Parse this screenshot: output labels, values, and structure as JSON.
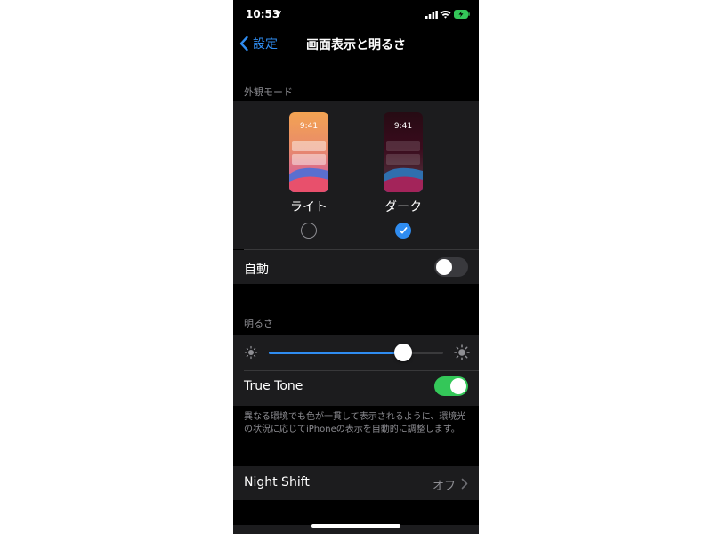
{
  "status_bar": {
    "time": "10:53"
  },
  "nav": {
    "back_label": "設定",
    "title": "画面表示と明るさ"
  },
  "appearance": {
    "section_title": "外観モード",
    "options": [
      {
        "label": "ライト",
        "preview_time": "9:41",
        "selected": false
      },
      {
        "label": "ダーク",
        "preview_time": "9:41",
        "selected": true
      }
    ],
    "auto_label": "自動",
    "auto_enabled": false
  },
  "brightness": {
    "section_title": "明るさ",
    "level": 0.77,
    "true_tone_label": "True Tone",
    "true_tone_enabled": true,
    "footer": "異なる環境でも色が一貫して表示されるように、環境光の状況に応じてiPhoneの表示を自動的に調整します。"
  },
  "night_shift": {
    "label": "Night Shift",
    "value": "オフ"
  },
  "colors": {
    "accent": "#2f8cf0",
    "toggle_on": "#34c759",
    "background": "#000000",
    "cell": "#1c1c1e",
    "secondary_text": "#8e8e93"
  },
  "icons": {
    "status": [
      "location-arrow-icon",
      "signal-icon",
      "wifi-icon",
      "battery-charging-icon"
    ],
    "brightness": [
      "sun-small-icon",
      "sun-large-icon"
    ],
    "navigation": [
      "chevron-left-icon",
      "chevron-right-icon"
    ],
    "selection": "checkmark-icon"
  }
}
